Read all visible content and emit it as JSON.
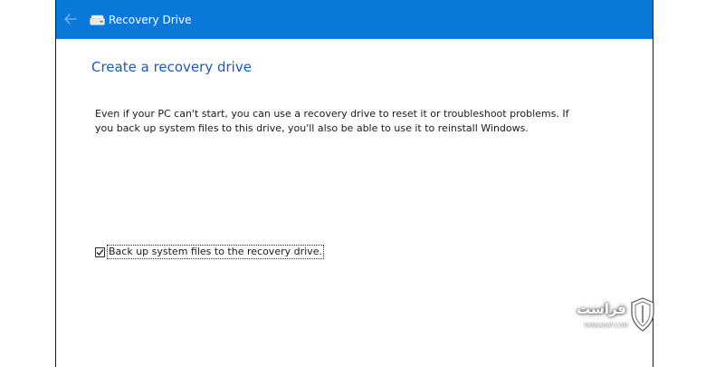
{
  "window": {
    "title": "Recovery Drive",
    "titlebar_color": "#0a78d7",
    "back_icon": "back-arrow-icon",
    "app_icon": "drive-icon"
  },
  "content": {
    "title": "Create a recovery drive",
    "title_color": "#1e5ab0",
    "description": "Even if your PC can't start, you can use a recovery drive to reset it or troubleshoot problems. If you back up system files to this drive, you'll also be able to use it to reinstall Windows.",
    "backup_checkbox": {
      "label": "Back up system files to the recovery drive.",
      "checked": true
    }
  },
  "watermark": {
    "text": "فراست",
    "subtext": "FARAASAT.COM",
    "icon": "shield-icon"
  }
}
